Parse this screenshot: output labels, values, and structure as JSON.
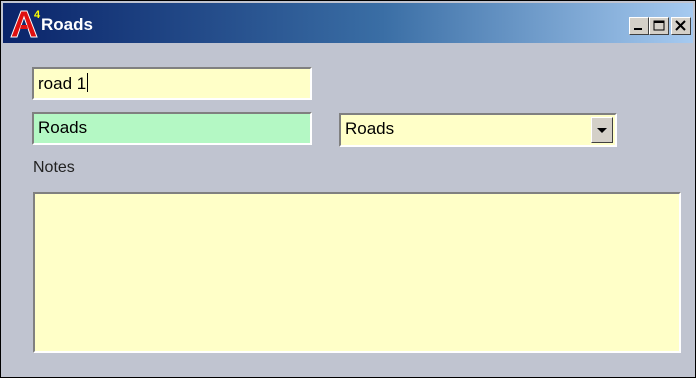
{
  "window": {
    "title": "Roads"
  },
  "form": {
    "name_value": "road 1",
    "layer_value": "Roads",
    "layer_select": {
      "selected": "Roads"
    },
    "notes_label": "Notes",
    "notes_value": ""
  },
  "colors": {
    "input_yellow": "#ffffc8",
    "input_green": "#b4f8c4",
    "window_bg": "#c0c4d0",
    "title_start": "#0a246a"
  }
}
